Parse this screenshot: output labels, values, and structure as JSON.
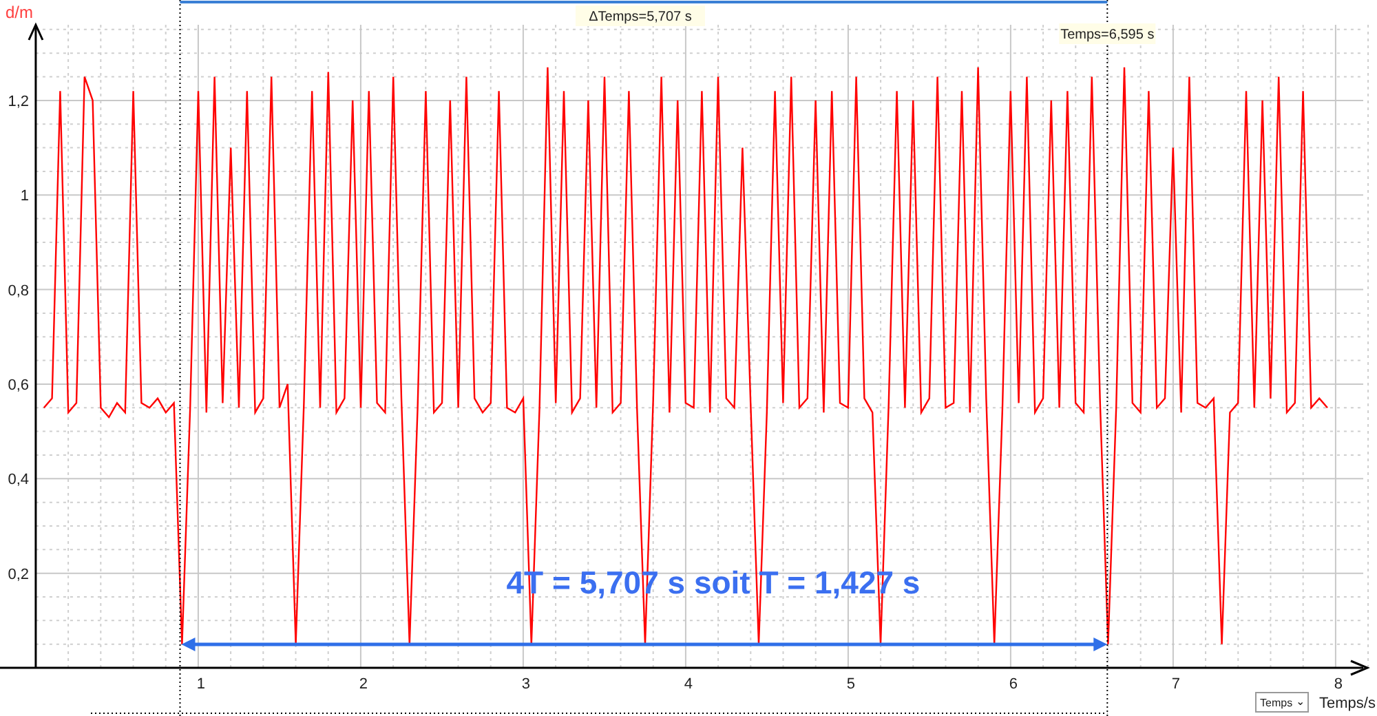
{
  "chart": {
    "chart_data": {
      "type": "line",
      "xlabel": "Temps/s",
      "ylabel": "d/m",
      "xlim": [
        -0.22,
        8.17
      ],
      "ylim": [
        0,
        1.36
      ],
      "grid": true,
      "ref_lines": [
        {
          "axis": "x",
          "value": 0.888
        },
        {
          "axis": "x",
          "value": 6.595
        }
      ],
      "xticks": [
        {
          "value": 1,
          "label": "1"
        },
        {
          "value": 2,
          "label": "2"
        },
        {
          "value": 3,
          "label": "3"
        },
        {
          "value": 4,
          "label": "4"
        },
        {
          "value": 5,
          "label": "5"
        },
        {
          "value": 6,
          "label": "6"
        },
        {
          "value": 7,
          "label": "7"
        },
        {
          "value": 8,
          "label": "8"
        }
      ],
      "yticks": [
        {
          "value": 1.2,
          "label": "1,2"
        },
        {
          "value": 1,
          "label": "1"
        },
        {
          "value": 0.8,
          "label": "0,8"
        },
        {
          "value": 0.6,
          "label": "0,6"
        },
        {
          "value": 0.4,
          "label": "0,4"
        },
        {
          "value": 0.2,
          "label": "0,2"
        }
      ],
      "x": [
        0.05,
        0.1,
        0.15,
        0.2,
        0.25,
        0.3,
        0.35,
        0.4,
        0.45,
        0.5,
        0.55,
        0.6,
        0.65,
        0.7,
        0.75,
        0.8,
        0.85,
        0.9,
        0.95,
        1,
        1.05,
        1.1,
        1.15,
        1.2,
        1.25,
        1.3,
        1.35,
        1.4,
        1.45,
        1.5,
        1.55,
        1.6,
        1.65,
        1.7,
        1.75,
        1.8,
        1.85,
        1.9,
        1.95,
        2,
        2.05,
        2.1,
        2.15,
        2.2,
        2.25,
        2.3,
        2.35,
        2.4,
        2.45,
        2.5,
        2.55,
        2.6,
        2.65,
        2.7,
        2.75,
        2.8,
        2.85,
        2.9,
        2.95,
        3,
        3.05,
        3.1,
        3.15,
        3.2,
        3.25,
        3.3,
        3.35,
        3.4,
        3.45,
        3.5,
        3.55,
        3.6,
        3.65,
        3.7,
        3.75,
        3.8,
        3.85,
        3.9,
        3.95,
        4,
        4.05,
        4.1,
        4.15,
        4.2,
        4.25,
        4.3,
        4.35,
        4.4,
        4.45,
        4.5,
        4.55,
        4.6,
        4.65,
        4.7,
        4.75,
        4.8,
        4.85,
        4.9,
        4.95,
        5,
        5.05,
        5.1,
        5.15,
        5.2,
        5.25,
        5.3,
        5.35,
        5.4,
        5.45,
        5.5,
        5.55,
        5.6,
        5.65,
        5.7,
        5.75,
        5.8,
        5.85,
        5.9,
        5.95,
        6,
        6.05,
        6.1,
        6.15,
        6.2,
        6.25,
        6.3,
        6.35,
        6.4,
        6.45,
        6.5,
        6.55,
        6.6,
        6.65,
        6.7,
        6.75,
        6.8,
        6.85,
        6.9,
        6.95,
        7,
        7.05,
        7.1,
        7.15,
        7.2,
        7.25,
        7.3,
        7.35,
        7.4,
        7.45,
        7.5,
        7.55,
        7.6,
        7.65,
        7.7,
        7.75,
        7.8,
        7.85,
        7.9,
        7.95
      ],
      "series": [
        {
          "color": "#ff0000",
          "values": [
            0.55,
            0.57,
            1.22,
            0.54,
            0.56,
            1.25,
            1.2,
            0.55,
            0.53,
            0.56,
            0.54,
            1.22,
            0.56,
            0.55,
            0.57,
            0.54,
            0.56,
            0.05,
            0.55,
            1.22,
            0.54,
            1.25,
            0.56,
            1.1,
            0.55,
            1.22,
            0.54,
            0.57,
            1.25,
            0.55,
            0.6,
            0.05,
            0.56,
            1.22,
            0.55,
            1.26,
            0.54,
            0.57,
            1.2,
            0.55,
            1.22,
            0.56,
            0.54,
            1.25,
            0.57,
            0.05,
            0.55,
            1.22,
            0.54,
            0.56,
            1.2,
            0.55,
            1.25,
            0.57,
            0.54,
            0.56,
            1.22,
            0.55,
            0.54,
            0.57,
            0.05,
            0.55,
            1.27,
            0.56,
            1.22,
            0.54,
            0.57,
            1.2,
            0.55,
            1.25,
            0.54,
            0.56,
            1.22,
            0.55,
            0.05,
            0.57,
            1.25,
            0.54,
            1.2,
            0.56,
            0.55,
            1.22,
            0.54,
            1.25,
            0.57,
            0.55,
            1.1,
            0.56,
            0.05,
            0.54,
            1.22,
            0.56,
            1.25,
            0.55,
            0.57,
            1.2,
            0.54,
            1.22,
            0.56,
            0.55,
            1.25,
            0.57,
            0.54,
            0.05,
            0.56,
            1.22,
            0.55,
            1.2,
            0.54,
            0.57,
            1.25,
            0.55,
            0.56,
            1.22,
            0.54,
            1.27,
            0.57,
            0.05,
            0.55,
            1.22,
            0.56,
            1.25,
            0.54,
            0.57,
            1.2,
            0.55,
            1.22,
            0.56,
            0.54,
            1.25,
            0.57,
            0.05,
            0.55,
            1.27,
            0.56,
            0.54,
            1.22,
            0.55,
            0.57,
            1.1,
            0.54,
            1.25,
            0.56,
            0.55,
            0.57,
            0.05,
            0.54,
            0.56,
            1.22,
            0.55,
            1.2,
            0.57,
            1.25,
            0.54,
            0.56,
            1.22,
            0.55,
            0.57,
            0.55
          ]
        }
      ]
    },
    "delta_label": "ΔTemps=5,707 s",
    "cursor_label": "Temps=6,595 s",
    "annotation": "4T = 5,707 s soit T = 1,427 s",
    "axis_selector": {
      "value": "Temps",
      "caret": "⌄"
    }
  }
}
